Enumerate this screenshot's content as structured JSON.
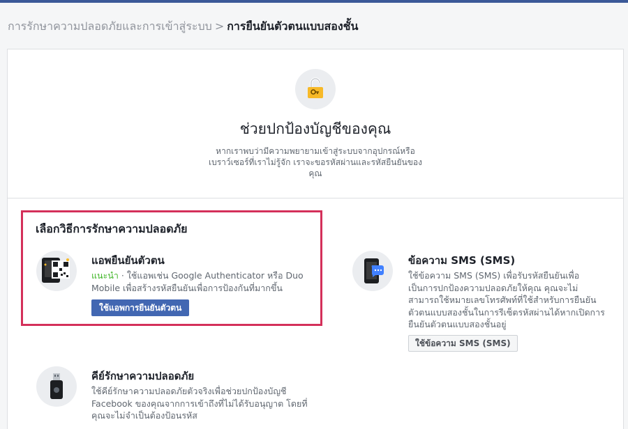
{
  "breadcrumb": {
    "parent": "การรักษาความปลอดภัยและการเข้าสู่ระบบ",
    "separator": ">",
    "current": "การยืนยันตัวตนแบบสองชั้น"
  },
  "hero": {
    "icon": "lock-key-icon",
    "title": "ช่วยปกป้องบัญชีของคุณ",
    "description": "หากเราพบว่ามีความพยายามเข้าสู่ระบบจากอุปกรณ์หรือเบราว์เซอร์ที่เราไม่รู้จัก เราจะขอรหัสผ่านและรหัสยืนยันของคุณ"
  },
  "methods": {
    "title": "เลือกวิธีการรักษาความปลอดภัย",
    "auth_app": {
      "icon": "qr-phone-icon",
      "title": "แอพยืนยันตัวตน",
      "recommended": "แนะนำ",
      "dot": " · ",
      "description": "ใช้แอพเช่น Google Authenticator หรือ Duo Mobile เพื่อสร้างรหัสยืนยันเพื่อการป้องกันที่มากขึ้น",
      "button": "ใช้แอพการยืนยันตัวตน"
    },
    "sms": {
      "icon": "phone-message-icon",
      "title": "ข้อความ SMS (SMS)",
      "description": "ใช้ข้อความ SMS (SMS) เพื่อรับรหัสยืนยันเพื่อเป็นการปกป้องความปลอดภัยให้คุณ คุณจะไม่สามารถใช้หมายเลขโทรศัพท์ที่ใช้สำหรับการยืนยันตัวตนแบบสองชั้นในการรีเซ็ตรหัสผ่านได้หากเปิดการยืนยันตัวตนแบบสองชั้นอยู่",
      "button": "ใช้ข้อความ SMS (SMS)"
    },
    "security_key": {
      "icon": "usb-key-icon",
      "title": "คีย์รักษาความปลอดภัย",
      "description": "ใช้คีย์รักษาความปลอดภัยตัวจริงเพื่อช่วยปกป้องบัญชี Facebook ของคุณจากการเข้าถึงที่ไม่ได้รับอนุญาต โดยที่คุณจะไม่จำเป็นต้องป้อนรหัส"
    }
  },
  "colors": {
    "accent": "#4267b2",
    "highlight_border": "#d4305a",
    "recommended": "#42b72a"
  }
}
